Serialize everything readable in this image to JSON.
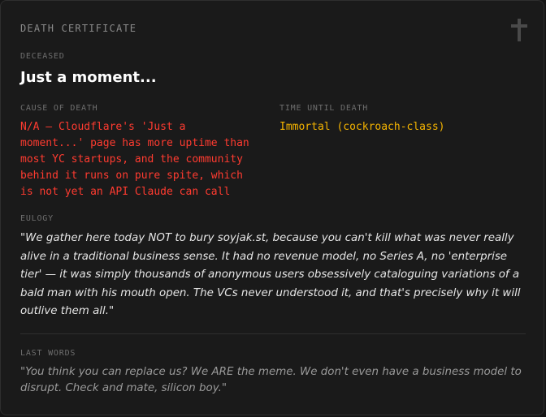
{
  "certificate": {
    "title": "DEATH CERTIFICATE",
    "icon": "cross-icon",
    "deceased_label": "DECEASED",
    "deceased_name": "Just a moment...",
    "cause_label": "CAUSE OF DEATH",
    "cause_text": "N/A — Cloudflare's 'Just a\nmoment...' page has more uptime than\nmost YC startups, and the community\nbehind it runs on pure spite, which\nis not yet an API Claude can call",
    "time_label": "TIME UNTIL DEATH",
    "time_text": "Immortal (cockroach-class)",
    "eulogy_label": "EULOGY",
    "eulogy_text": "\"We gather here today NOT to bury soyjak.st, because you can't kill what was never really alive in a traditional business sense. It had no revenue model, no Series A, no 'enterprise tier' — it was simply thousands of anonymous users obsessively cataloguing variations of a bald man with his mouth open. The VCs never understood it, and that's precisely why it will outlive them all.\"",
    "last_words_label": "LAST WORDS",
    "last_words_text": "\"You think you can replace us? We ARE the meme. We don't even have a business model to disrupt. Check and mate, silicon boy.\""
  },
  "colors": {
    "background": "#1a1a1a",
    "cause": "#ff3b30",
    "time": "#f5b400",
    "label": "#6e6e6e"
  }
}
